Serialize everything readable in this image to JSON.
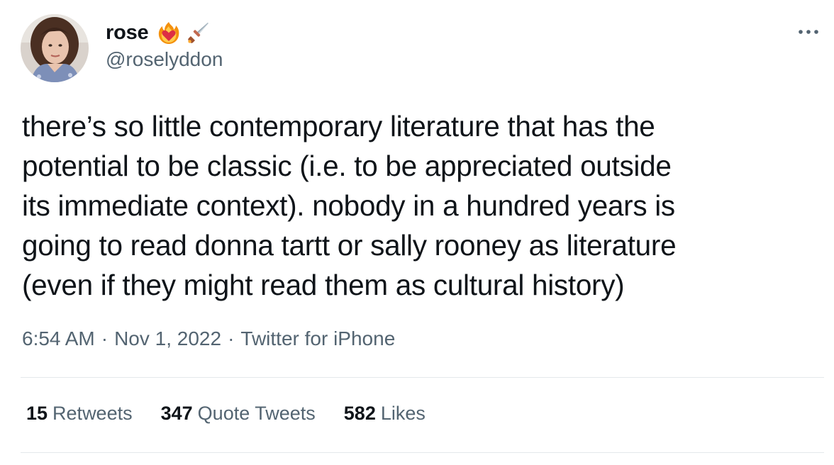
{
  "author": {
    "display_name": "rose",
    "handle": "@roselyddon",
    "emojis": [
      "heart-on-fire-icon",
      "dagger-icon"
    ]
  },
  "tweet": {
    "text": "there’s so little contemporary literature that has the\npotential to be classic (i.e. to be appreciated outside\nits immediate context). nobody in a hundred years is\ngoing to read donna tartt or sally rooney as literature\n(even if they might read them as cultural history)",
    "time": "6:54 AM",
    "separator": "·",
    "date": "Nov 1, 2022",
    "source": "Twitter for iPhone"
  },
  "stats": {
    "retweets": {
      "count": "15",
      "label": "Retweets"
    },
    "quote_tweets": {
      "count": "347",
      "label": "Quote Tweets"
    },
    "likes": {
      "count": "582",
      "label": "Likes"
    }
  },
  "colors": {
    "text_primary": "#0f1419",
    "text_secondary": "#536471",
    "divider": "#e4e8eb"
  }
}
